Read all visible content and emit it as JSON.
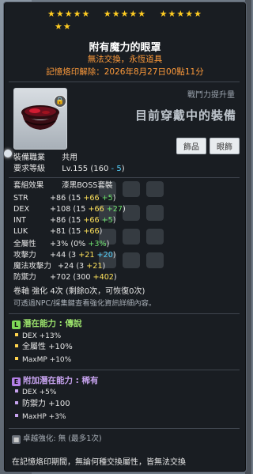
{
  "stars": {
    "row1": [
      "★★★★★",
      "★★★★★",
      "★★★★★"
    ],
    "row2": "★★"
  },
  "item": {
    "name": "附有魔力的眼罩",
    "subtitle": "無法交換，永恆道具",
    "seal_text": "記憶烙印解除：2026年8月27日00點11分",
    "icon_name": "eyepatch-icon"
  },
  "power_label": "戰鬥力提升量",
  "equipped_text": "目前穿戴中的裝備",
  "tags": [
    "飾品",
    "眼飾"
  ],
  "requirements": {
    "job_label": "裝備職業",
    "job_value": "共用",
    "level_label": "要求等級",
    "level_value": "Lv.155",
    "level_detail": "(160",
    "level_minus": "- 5",
    "level_close": ")"
  },
  "set_effect": {
    "label": "套組效果",
    "value": "漆黑BOSS套裝"
  },
  "stats": [
    {
      "label": "STR",
      "base": "+86",
      "open": "(15",
      "add1": "+66",
      "add2": "+5",
      "close": ")"
    },
    {
      "label": "DEX",
      "base": "+108",
      "open": "(15",
      "add1": "+66",
      "add2": "+27",
      "close": ")"
    },
    {
      "label": "INT",
      "base": "+86",
      "open": "(15",
      "add1": "+66",
      "add2": "+5",
      "close": ")"
    },
    {
      "label": "LUK",
      "base": "+81",
      "open": "(15",
      "add1": "+66",
      "add2": "",
      "close": ")"
    },
    {
      "label": "全屬性",
      "base": "+3%",
      "open": "(0%",
      "add1": "",
      "add2": "+3%",
      "close": ")"
    },
    {
      "label": "攻擊力",
      "base": "+44",
      "open": "(3",
      "add1": "+21",
      "add2": "+20",
      "close": ")"
    },
    {
      "label": "魔法攻擊力",
      "base": "+24",
      "open": "(3",
      "add1": "+21",
      "add2": "",
      "close": ")"
    },
    {
      "label": "防禦力",
      "base": "+702",
      "open": "(300",
      "add1": "+402",
      "add2": "",
      "close": ")"
    }
  ],
  "scroll_line": "卷軸 強化 4次 (剩餘0次，可恢復0次)",
  "npc_line": "可透過NPC/採集鍵查看強化資訊詳細內容。",
  "potential": {
    "icon": "L",
    "title": "潛在能力 : 傳說",
    "lines": [
      "DEX +13%",
      "全屬性 +10%",
      "MaxMP +10%"
    ]
  },
  "additional_potential": {
    "icon": "E",
    "title": "附加潛在能力 : 稀有",
    "lines": [
      "DEX +5%",
      "防禦力 +100",
      "MaxHP +3%"
    ]
  },
  "star_force": "卓越強化:  無 (最多1次)",
  "footer": "在記憶烙印期間，無論何種交換屬性，皆無法交換",
  "colors": {
    "accent_orange": "#ff9b3b",
    "yellow": "#ffe35c",
    "green": "#6ee06e",
    "cyan": "#55d3ff",
    "legendary": "#7ed957",
    "rare": "#b37fe6"
  }
}
